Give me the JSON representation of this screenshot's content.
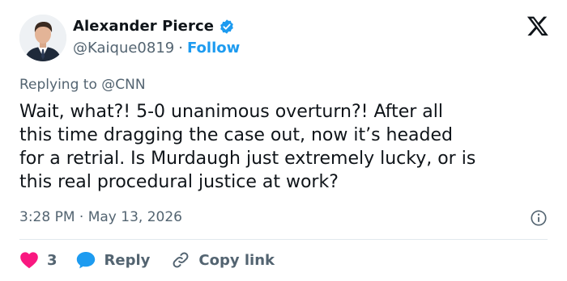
{
  "author": {
    "name": "Alexander Pierce",
    "handle": "@Kaique0819",
    "separator": "·",
    "follow_label": "Follow"
  },
  "reply_context": {
    "text": "Replying to @CNN"
  },
  "tweet": {
    "text": "Wait, what?! 5-0 unanimous overturn?! After all\nthis time dragging the case out, now it’s headed\nfor a retrial. Is Murdaugh just extremely lucky, or is\nthis real procedural justice at work?",
    "timestamp": "3:28 PM · May 13, 2026"
  },
  "actions": {
    "like_count": "3",
    "reply_label": "Reply",
    "copy_link_label": "Copy link"
  },
  "colors": {
    "accent": "#1d9bf0",
    "like": "#f91880",
    "muted": "#536471",
    "text": "#0f1419"
  },
  "icons": [
    "verified-badge-icon",
    "x-logo-icon",
    "info-icon",
    "heart-icon",
    "reply-bubble-icon",
    "link-icon"
  ]
}
